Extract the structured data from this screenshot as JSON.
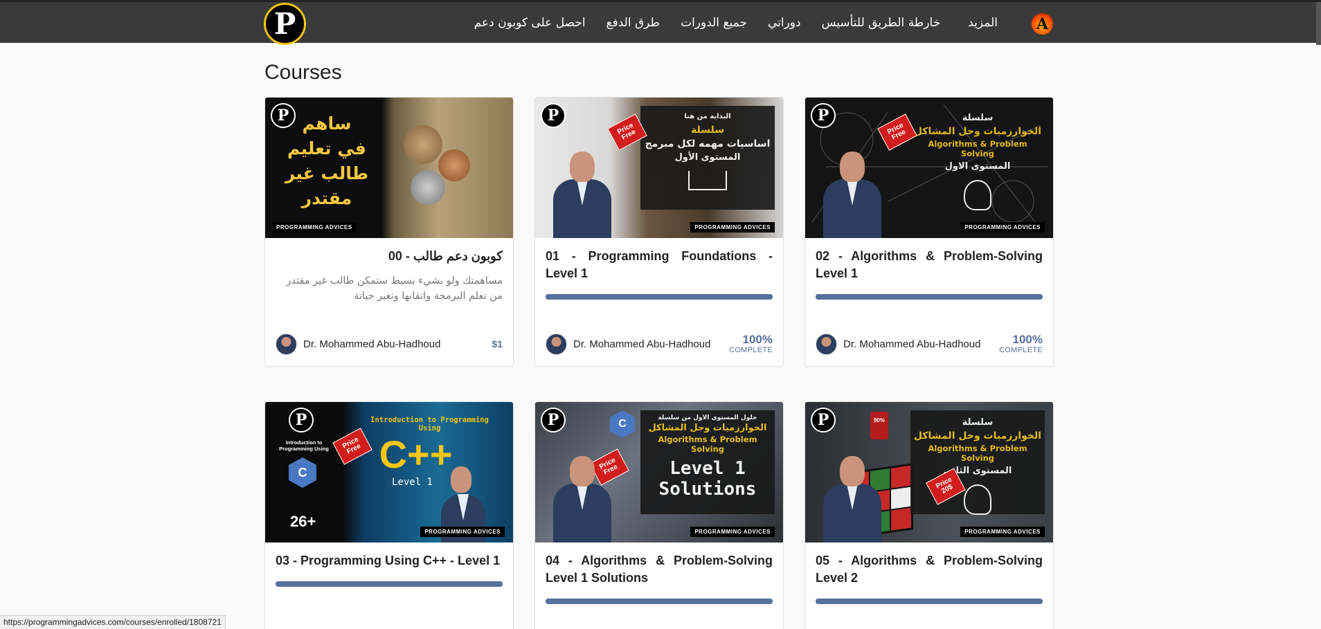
{
  "nav": {
    "links": [
      "المزيد",
      "خارطة الطريق للتأسيس",
      "دوراتي",
      "جميع الدورات",
      "طرق الدفع",
      "احصل على كوبون دعم"
    ],
    "avatar_letter": "A"
  },
  "page": {
    "title": "Courses"
  },
  "courses": [
    {
      "title": "كوبون دعم طالب - 00",
      "description": "مساهمتك ولو بشيء بسيط ستمكن طالب غير مقتدر من تعلم البرمجة واتقانها وتغير حياتة",
      "author": "Dr. Mohammed Abu-Hadhoud",
      "price": "$1",
      "thumb_text": [
        "ساهم",
        "في تعليم",
        "طالب غير",
        "مقتدر"
      ],
      "brand": "PROGRAMMING ADVICES"
    },
    {
      "title": "01 - Programming Foundations - Level 1",
      "author": "Dr. Mohammed Abu-Hadhoud",
      "progress": 1.0,
      "complete_pct": "100%",
      "complete_label": "COMPLETE",
      "thumb_text": [
        "البداية من هنا",
        "سلسلة",
        "اساسيات مهمه لكل مبرمج",
        "المستوى الأول"
      ],
      "price_tag": [
        "Price",
        "Free"
      ],
      "brand": "PROGRAMMING ADVICES"
    },
    {
      "title": "02 - Algorithms & Problem-Solving Level 1",
      "author": "Dr. Mohammed Abu-Hadhoud",
      "progress": 1.0,
      "complete_pct": "100%",
      "complete_label": "COMPLETE",
      "thumb_text": [
        "سلسلة",
        "الخوارزميات وحل المشاكل",
        "Algorithms & Problem Solving",
        "المستوى الاول"
      ],
      "price_tag": [
        "Price",
        "Free"
      ],
      "brand": "PROGRAMMING ADVICES"
    },
    {
      "title": "03 - Programming Using C++ - Level 1",
      "progress": 1.0,
      "thumb_text": [
        "Introduction to Programming Using",
        "C++",
        "Level 1",
        "26+",
        "Introduction to Programming Using"
      ],
      "price_tag": [
        "Price",
        "Free"
      ],
      "brand": "PROGRAMMING ADVICES"
    },
    {
      "title": "04 - Algorithms & Problem-Solving Level 1 Solutions",
      "progress": 1.0,
      "thumb_text": [
        "حلول المستوى الاول من سلسلة",
        "الخوارزميات وحل المشاكل",
        "Algorithms & Problem Solving",
        "Level 1",
        "Solutions"
      ],
      "price_tag": [
        "Price",
        "Free"
      ],
      "brand": "PROGRAMMING ADVICES"
    },
    {
      "title": "05 - Algorithms & Problem-Solving Level 2",
      "progress": 1.0,
      "thumb_text": [
        "سلسلة",
        "الخوارزميات وحل المشاكل",
        "Algorithms & Problem Solving",
        "المستوى الثاني"
      ],
      "price_tag": [
        "Price",
        "20$"
      ],
      "discount": "90%",
      "brand": "PROGRAMMING ADVICES"
    }
  ],
  "status_bar": {
    "url": "https://programmingadvices.com/courses/enrolled/1808721"
  },
  "colors": {
    "navbar": "#3a3a3a",
    "accent": "#56709d",
    "logo_ring": "#f2c614",
    "price_tag": "#d21d1d"
  }
}
